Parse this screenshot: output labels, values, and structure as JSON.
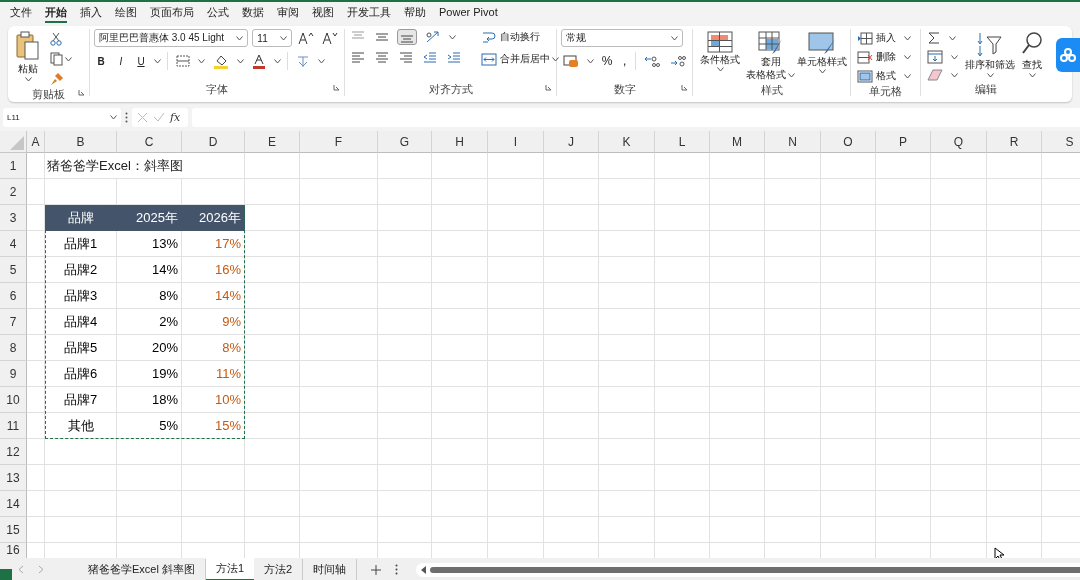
{
  "menu": [
    {
      "label": "文件",
      "selected": false
    },
    {
      "label": "开始",
      "selected": true
    },
    {
      "label": "插入",
      "selected": false
    },
    {
      "label": "绘图",
      "selected": false
    },
    {
      "label": "页面布局",
      "selected": false
    },
    {
      "label": "公式",
      "selected": false
    },
    {
      "label": "数据",
      "selected": false
    },
    {
      "label": "审阅",
      "selected": false
    },
    {
      "label": "视图",
      "selected": false
    },
    {
      "label": "开发工具",
      "selected": false
    },
    {
      "label": "帮助",
      "selected": false
    },
    {
      "label": "Power Pivot",
      "selected": false
    }
  ],
  "ribbon": {
    "clipboard": {
      "label": "剪贴板",
      "paste": "粘贴"
    },
    "font": {
      "label": "字体",
      "font_name": "阿里巴巴普惠体 3.0 45 Light",
      "font_size": "11",
      "style_buttons": [
        "B",
        "I",
        "U"
      ]
    },
    "alignment": {
      "label": "对齐方式",
      "vertical_align": [
        {
          "selected": false
        },
        {
          "selected": false
        },
        {
          "selected": true
        }
      ],
      "wrap_text": "自动换行",
      "merge_center": "合并后居中"
    },
    "number": {
      "label": "数字",
      "format": "常规",
      "percent": "%",
      "comma": ","
    },
    "styles": {
      "label": "样式",
      "buttons": [
        {
          "lines": [
            "条件格式"
          ]
        },
        {
          "lines": [
            "套用",
            "表格格式"
          ]
        },
        {
          "lines": [
            "单元格样式"
          ]
        }
      ]
    },
    "cells": {
      "label": "单元格",
      "buttons": [
        "插入",
        "删除",
        "格式"
      ]
    },
    "editing": {
      "label": "编辑",
      "sort_filter": "排序和筛选",
      "find_select": "查找"
    }
  },
  "formula_bar": {
    "name_box": "L11",
    "fx": "fx"
  },
  "sheet": {
    "columns": [
      "A",
      "B",
      "C",
      "D",
      "E",
      "F",
      "G",
      "H",
      "I",
      "J",
      "K",
      "L",
      "M",
      "N",
      "O",
      "P",
      "Q",
      "R",
      "S"
    ],
    "rows": [
      "1",
      "2",
      "3",
      "4",
      "5",
      "6",
      "7",
      "8",
      "9",
      "10",
      "11",
      "12",
      "13",
      "14",
      "15",
      "16"
    ],
    "title": "猪爸爸学Excel：斜率图",
    "table": {
      "columns": [
        {
          "label": "品牌",
          "color": "#000000"
        },
        {
          "label": "2025年",
          "color": "#000000"
        },
        {
          "label": "2026年",
          "color": "#c55a11"
        }
      ],
      "rows": [
        [
          "品牌1",
          "13%",
          "17%"
        ],
        [
          "品牌2",
          "14%",
          "16%"
        ],
        [
          "品牌3",
          "8%",
          "14%"
        ],
        [
          "品牌4",
          "2%",
          "9%"
        ],
        [
          "品牌5",
          "20%",
          "8%"
        ],
        [
          "品牌6",
          "19%",
          "11%"
        ],
        [
          "品牌7",
          "18%",
          "10%"
        ],
        [
          "其他",
          "5%",
          "15%"
        ]
      ]
    }
  },
  "sheet_tabs": [
    {
      "label": "猪爸爸学Excel 斜率图",
      "selected": false
    },
    {
      "label": "方法1",
      "selected": true
    },
    {
      "label": "方法2",
      "selected": false
    },
    {
      "label": "时间轴",
      "selected": false
    }
  ]
}
